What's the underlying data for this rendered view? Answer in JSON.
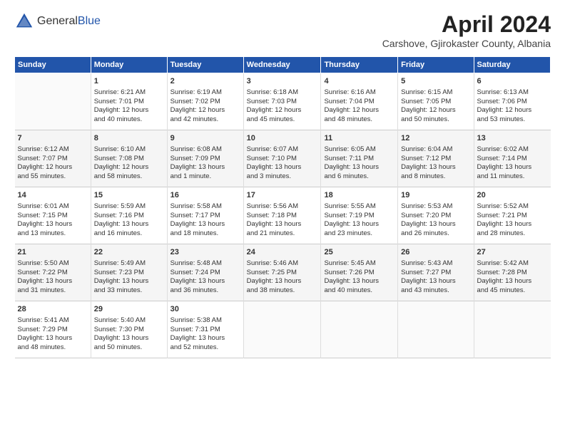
{
  "header": {
    "logo_general": "General",
    "logo_blue": "Blue",
    "month": "April 2024",
    "location": "Carshove, Gjirokaster County, Albania"
  },
  "weekdays": [
    "Sunday",
    "Monday",
    "Tuesday",
    "Wednesday",
    "Thursday",
    "Friday",
    "Saturday"
  ],
  "weeks": [
    [
      {
        "day": "",
        "info": ""
      },
      {
        "day": "1",
        "info": "Sunrise: 6:21 AM\nSunset: 7:01 PM\nDaylight: 12 hours\nand 40 minutes."
      },
      {
        "day": "2",
        "info": "Sunrise: 6:19 AM\nSunset: 7:02 PM\nDaylight: 12 hours\nand 42 minutes."
      },
      {
        "day": "3",
        "info": "Sunrise: 6:18 AM\nSunset: 7:03 PM\nDaylight: 12 hours\nand 45 minutes."
      },
      {
        "day": "4",
        "info": "Sunrise: 6:16 AM\nSunset: 7:04 PM\nDaylight: 12 hours\nand 48 minutes."
      },
      {
        "day": "5",
        "info": "Sunrise: 6:15 AM\nSunset: 7:05 PM\nDaylight: 12 hours\nand 50 minutes."
      },
      {
        "day": "6",
        "info": "Sunrise: 6:13 AM\nSunset: 7:06 PM\nDaylight: 12 hours\nand 53 minutes."
      }
    ],
    [
      {
        "day": "7",
        "info": "Sunrise: 6:12 AM\nSunset: 7:07 PM\nDaylight: 12 hours\nand 55 minutes."
      },
      {
        "day": "8",
        "info": "Sunrise: 6:10 AM\nSunset: 7:08 PM\nDaylight: 12 hours\nand 58 minutes."
      },
      {
        "day": "9",
        "info": "Sunrise: 6:08 AM\nSunset: 7:09 PM\nDaylight: 13 hours\nand 1 minute."
      },
      {
        "day": "10",
        "info": "Sunrise: 6:07 AM\nSunset: 7:10 PM\nDaylight: 13 hours\nand 3 minutes."
      },
      {
        "day": "11",
        "info": "Sunrise: 6:05 AM\nSunset: 7:11 PM\nDaylight: 13 hours\nand 6 minutes."
      },
      {
        "day": "12",
        "info": "Sunrise: 6:04 AM\nSunset: 7:12 PM\nDaylight: 13 hours\nand 8 minutes."
      },
      {
        "day": "13",
        "info": "Sunrise: 6:02 AM\nSunset: 7:14 PM\nDaylight: 13 hours\nand 11 minutes."
      }
    ],
    [
      {
        "day": "14",
        "info": "Sunrise: 6:01 AM\nSunset: 7:15 PM\nDaylight: 13 hours\nand 13 minutes."
      },
      {
        "day": "15",
        "info": "Sunrise: 5:59 AM\nSunset: 7:16 PM\nDaylight: 13 hours\nand 16 minutes."
      },
      {
        "day": "16",
        "info": "Sunrise: 5:58 AM\nSunset: 7:17 PM\nDaylight: 13 hours\nand 18 minutes."
      },
      {
        "day": "17",
        "info": "Sunrise: 5:56 AM\nSunset: 7:18 PM\nDaylight: 13 hours\nand 21 minutes."
      },
      {
        "day": "18",
        "info": "Sunrise: 5:55 AM\nSunset: 7:19 PM\nDaylight: 13 hours\nand 23 minutes."
      },
      {
        "day": "19",
        "info": "Sunrise: 5:53 AM\nSunset: 7:20 PM\nDaylight: 13 hours\nand 26 minutes."
      },
      {
        "day": "20",
        "info": "Sunrise: 5:52 AM\nSunset: 7:21 PM\nDaylight: 13 hours\nand 28 minutes."
      }
    ],
    [
      {
        "day": "21",
        "info": "Sunrise: 5:50 AM\nSunset: 7:22 PM\nDaylight: 13 hours\nand 31 minutes."
      },
      {
        "day": "22",
        "info": "Sunrise: 5:49 AM\nSunset: 7:23 PM\nDaylight: 13 hours\nand 33 minutes."
      },
      {
        "day": "23",
        "info": "Sunrise: 5:48 AM\nSunset: 7:24 PM\nDaylight: 13 hours\nand 36 minutes."
      },
      {
        "day": "24",
        "info": "Sunrise: 5:46 AM\nSunset: 7:25 PM\nDaylight: 13 hours\nand 38 minutes."
      },
      {
        "day": "25",
        "info": "Sunrise: 5:45 AM\nSunset: 7:26 PM\nDaylight: 13 hours\nand 40 minutes."
      },
      {
        "day": "26",
        "info": "Sunrise: 5:43 AM\nSunset: 7:27 PM\nDaylight: 13 hours\nand 43 minutes."
      },
      {
        "day": "27",
        "info": "Sunrise: 5:42 AM\nSunset: 7:28 PM\nDaylight: 13 hours\nand 45 minutes."
      }
    ],
    [
      {
        "day": "28",
        "info": "Sunrise: 5:41 AM\nSunset: 7:29 PM\nDaylight: 13 hours\nand 48 minutes."
      },
      {
        "day": "29",
        "info": "Sunrise: 5:40 AM\nSunset: 7:30 PM\nDaylight: 13 hours\nand 50 minutes."
      },
      {
        "day": "30",
        "info": "Sunrise: 5:38 AM\nSunset: 7:31 PM\nDaylight: 13 hours\nand 52 minutes."
      },
      {
        "day": "",
        "info": ""
      },
      {
        "day": "",
        "info": ""
      },
      {
        "day": "",
        "info": ""
      },
      {
        "day": "",
        "info": ""
      }
    ]
  ]
}
